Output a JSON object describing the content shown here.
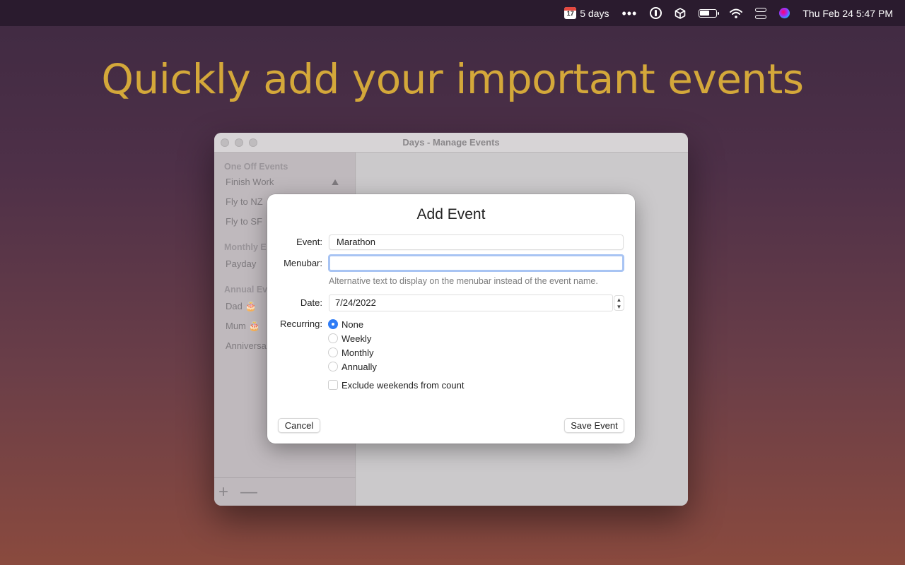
{
  "menubar": {
    "calendar_day": "17",
    "days_label": "5 days",
    "more_dots": "•••",
    "clock": "Thu Feb 24  5:47 PM"
  },
  "headline": "Quickly add your important events",
  "window": {
    "title": "Days - Manage Events",
    "sidebar": {
      "sections": [
        {
          "title": "One Off Events",
          "items": [
            {
              "label": "Finish Work",
              "emoji": "⛰"
            },
            {
              "label": "Fly to NZ",
              "emoji": ""
            },
            {
              "label": "Fly to SF",
              "emoji": ""
            }
          ]
        },
        {
          "title": "Monthly E",
          "items": [
            {
              "label": "Payday",
              "emoji": ""
            }
          ]
        },
        {
          "title": "Annual Ev",
          "items": [
            {
              "label": "Dad 🎂",
              "emoji": ""
            },
            {
              "label": "Mum 🎂",
              "emoji": ""
            },
            {
              "label": "Anniversa",
              "emoji": ""
            }
          ]
        }
      ],
      "add_label": "+",
      "remove_label": "—"
    }
  },
  "dialog": {
    "title": "Add Event",
    "event_label": "Event:",
    "event_value": "Marathon",
    "menubar_label": "Menubar:",
    "menubar_value": "",
    "menubar_hint": "Alternative text to display on the menubar instead of the event name.",
    "date_label": "Date:",
    "date_value": "7/24/2022",
    "stepper_up": "▲",
    "stepper_down": "▼",
    "recurring_label": "Recurring:",
    "recurring_options": [
      "None",
      "Weekly",
      "Monthly",
      "Annually"
    ],
    "recurring_selected": "None",
    "exclude_weekends_label": "Exclude weekends from count",
    "exclude_weekends_checked": false,
    "cancel_label": "Cancel",
    "save_label": "Save Event"
  },
  "colors": {
    "headline": "#d4a83a",
    "accent": "#2f7cf6",
    "focus_ring": "#a8c4f3"
  }
}
